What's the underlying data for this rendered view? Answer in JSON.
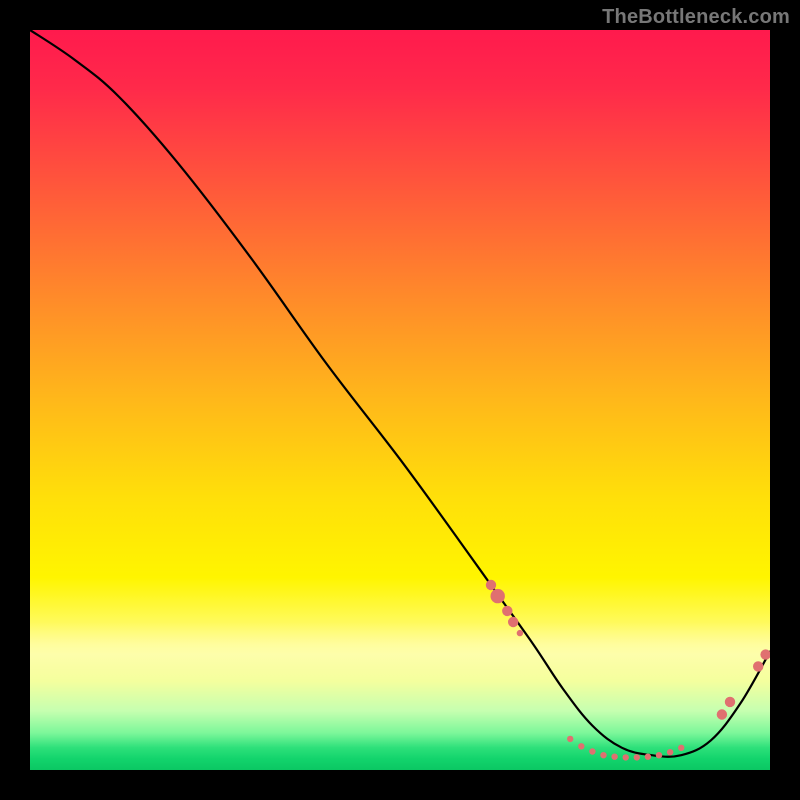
{
  "watermark": "TheBottleneck.com",
  "chart_data": {
    "type": "line",
    "title": "",
    "xlabel": "",
    "ylabel": "",
    "xlim": [
      0,
      100
    ],
    "ylim": [
      0,
      100
    ],
    "grid": false,
    "series": [
      {
        "name": "bottleneck-curve",
        "x": [
          0,
          6,
          12,
          20,
          30,
          40,
          50,
          58,
          63,
          68,
          72,
          76,
          80,
          84,
          88,
          92,
          96,
          100
        ],
        "y": [
          100,
          96,
          91,
          82,
          69,
          55,
          42,
          31,
          24,
          17,
          11,
          6,
          3,
          2,
          2,
          4,
          9,
          16
        ]
      }
    ],
    "marker_clusters": [
      {
        "name": "descent-cluster",
        "points": [
          {
            "x": 62.3,
            "y": 25.0,
            "size": "m"
          },
          {
            "x": 63.2,
            "y": 23.5,
            "size": "l"
          },
          {
            "x": 64.5,
            "y": 21.5,
            "size": "m"
          },
          {
            "x": 65.3,
            "y": 20.0,
            "size": "m"
          },
          {
            "x": 66.2,
            "y": 18.5,
            "size": "s"
          }
        ]
      },
      {
        "name": "valley-cluster",
        "points": [
          {
            "x": 73.0,
            "y": 4.2,
            "size": "s"
          },
          {
            "x": 74.5,
            "y": 3.2,
            "size": "s"
          },
          {
            "x": 76.0,
            "y": 2.5,
            "size": "s"
          },
          {
            "x": 77.5,
            "y": 2.0,
            "size": "s"
          },
          {
            "x": 79.0,
            "y": 1.8,
            "size": "s"
          },
          {
            "x": 80.5,
            "y": 1.7,
            "size": "s"
          },
          {
            "x": 82.0,
            "y": 1.7,
            "size": "s"
          },
          {
            "x": 83.5,
            "y": 1.8,
            "size": "s"
          },
          {
            "x": 85.0,
            "y": 2.0,
            "size": "s"
          },
          {
            "x": 86.5,
            "y": 2.4,
            "size": "s"
          },
          {
            "x": 88.0,
            "y": 3.0,
            "size": "s"
          }
        ]
      },
      {
        "name": "ascent-cluster",
        "points": [
          {
            "x": 93.5,
            "y": 7.5,
            "size": "m"
          },
          {
            "x": 94.6,
            "y": 9.2,
            "size": "m"
          },
          {
            "x": 98.4,
            "y": 14.0,
            "size": "m"
          },
          {
            "x": 99.4,
            "y": 15.6,
            "size": "m"
          }
        ]
      }
    ],
    "gradient": {
      "top": "#ff1a4d",
      "mid": "#ffdf0a",
      "bottom": "#0bc763"
    }
  }
}
